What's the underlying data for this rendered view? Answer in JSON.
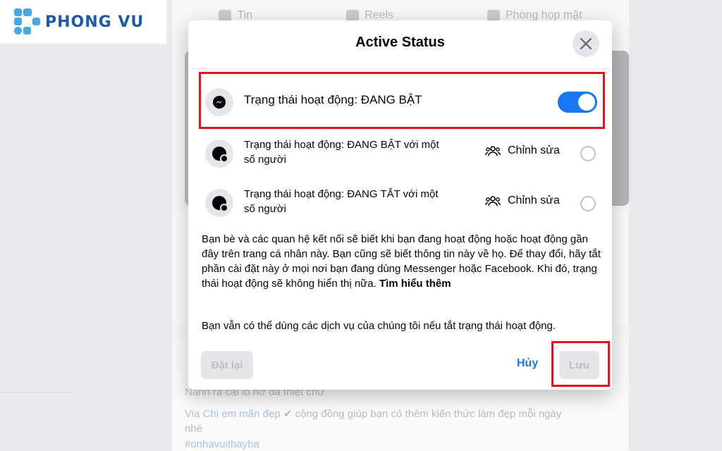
{
  "logo": {
    "text": "PHONG VU"
  },
  "background": {
    "tabs": [
      "Tin",
      "Reels",
      "Phòng họp mặt"
    ],
    "post_line1": "Nành ra cái lõ hở đã thiệt chứ",
    "post_via": "Via",
    "post_group": "Chị em mãn đẹp",
    "post_line2": "cộng đồng giúp bạn có thêm kiến thức làm đẹp mỗi ngày",
    "post_line3": "nhé",
    "post_hashtag": "#onhavuithayba"
  },
  "modal": {
    "title": "Active Status",
    "options": [
      {
        "label": "Trạng thái hoạt động: ĐANG BẬT",
        "state": "on"
      },
      {
        "label_line1": "Trạng thái hoạt động: ĐANG BẬT với một",
        "label_line2": "số người",
        "edit": "Chỉnh sửa"
      },
      {
        "label_line1": "Trạng thái hoạt động: ĐANG TẮT với một",
        "label_line2": "số người",
        "edit": "Chỉnh sửa"
      }
    ],
    "description": "Bạn bè và các quan hệ kết nối sẽ biết khi bạn đang hoạt động hoặc hoạt động gần đây trên trang cá nhân này. Bạn cũng sẽ biết thông tin này về họ. Để thay đổi, hãy tắt phần cài đặt này ở mọi nơi bạn đang dùng Messenger hoặc Facebook. Khi đó, trạng thái hoạt động sẽ không hiển thị nữa.",
    "learn_more": "Tìm hiểu thêm",
    "note": "Bạn vẫn có thể dùng các dịch vụ của chúng tôi nếu tắt trạng thái hoạt động.",
    "reset_button": "Đặt lại",
    "cancel_button": "Hủy",
    "save_button": "Lưu"
  },
  "colors": {
    "accent": "#1877f2",
    "highlight": "#e0141c"
  }
}
